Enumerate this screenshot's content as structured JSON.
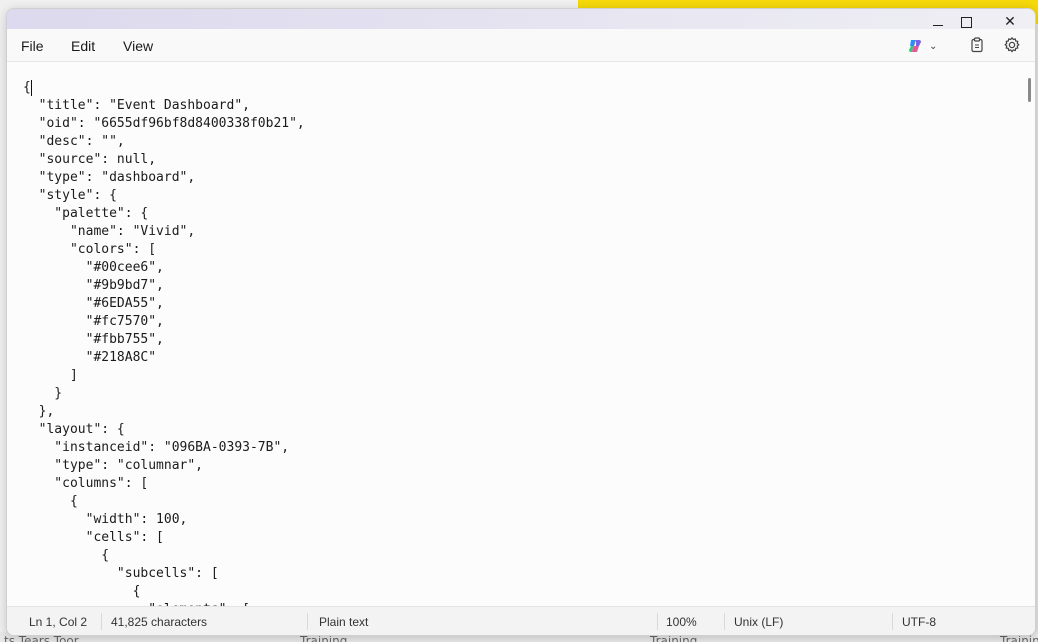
{
  "background": {
    "bottom_text": [
      "ts Tears Toor",
      "Training",
      "Training",
      "Training"
    ]
  },
  "menu": {
    "file": "File",
    "edit": "Edit",
    "view": "View"
  },
  "toolbar": {
    "copilot_icon": "copilot-icon",
    "chevron_icon": "chevron-down-icon",
    "clipboard_icon": "clipboard-icon",
    "settings_icon": "gear-icon"
  },
  "window_controls": {
    "minimize_icon": "minimize-icon",
    "maximize_icon": "maximize-icon",
    "close_icon": "close-icon"
  },
  "editor": {
    "content": "{\n  \"title\": \"Event Dashboard\",\n  \"oid\": \"6655df96bf8d8400338f0b21\",\n  \"desc\": \"\",\n  \"source\": null,\n  \"type\": \"dashboard\",\n  \"style\": {\n    \"palette\": {\n      \"name\": \"Vivid\",\n      \"colors\": [\n        \"#00cee6\",\n        \"#9b9bd7\",\n        \"#6EDA55\",\n        \"#fc7570\",\n        \"#fbb755\",\n        \"#218A8C\"\n      ]\n    }\n  },\n  \"layout\": {\n    \"instanceid\": \"096BA-0393-7B\",\n    \"type\": \"columnar\",\n    \"columns\": [\n      {\n        \"width\": 100,\n        \"cells\": [\n          {\n            \"subcells\": [\n              {\n                \"elements\": ["
  },
  "status": {
    "position": "Ln 1, Col 2",
    "characters": "41,825 characters",
    "format": "Plain text",
    "zoom": "100%",
    "line_ending": "Unix (LF)",
    "encoding": "UTF-8"
  },
  "colors": {
    "accent_yellow": "#f5d90a",
    "titlebar": "#ddd9ee",
    "editor_bg": "#fcfcfc",
    "status_bg": "#f3f3f3"
  }
}
